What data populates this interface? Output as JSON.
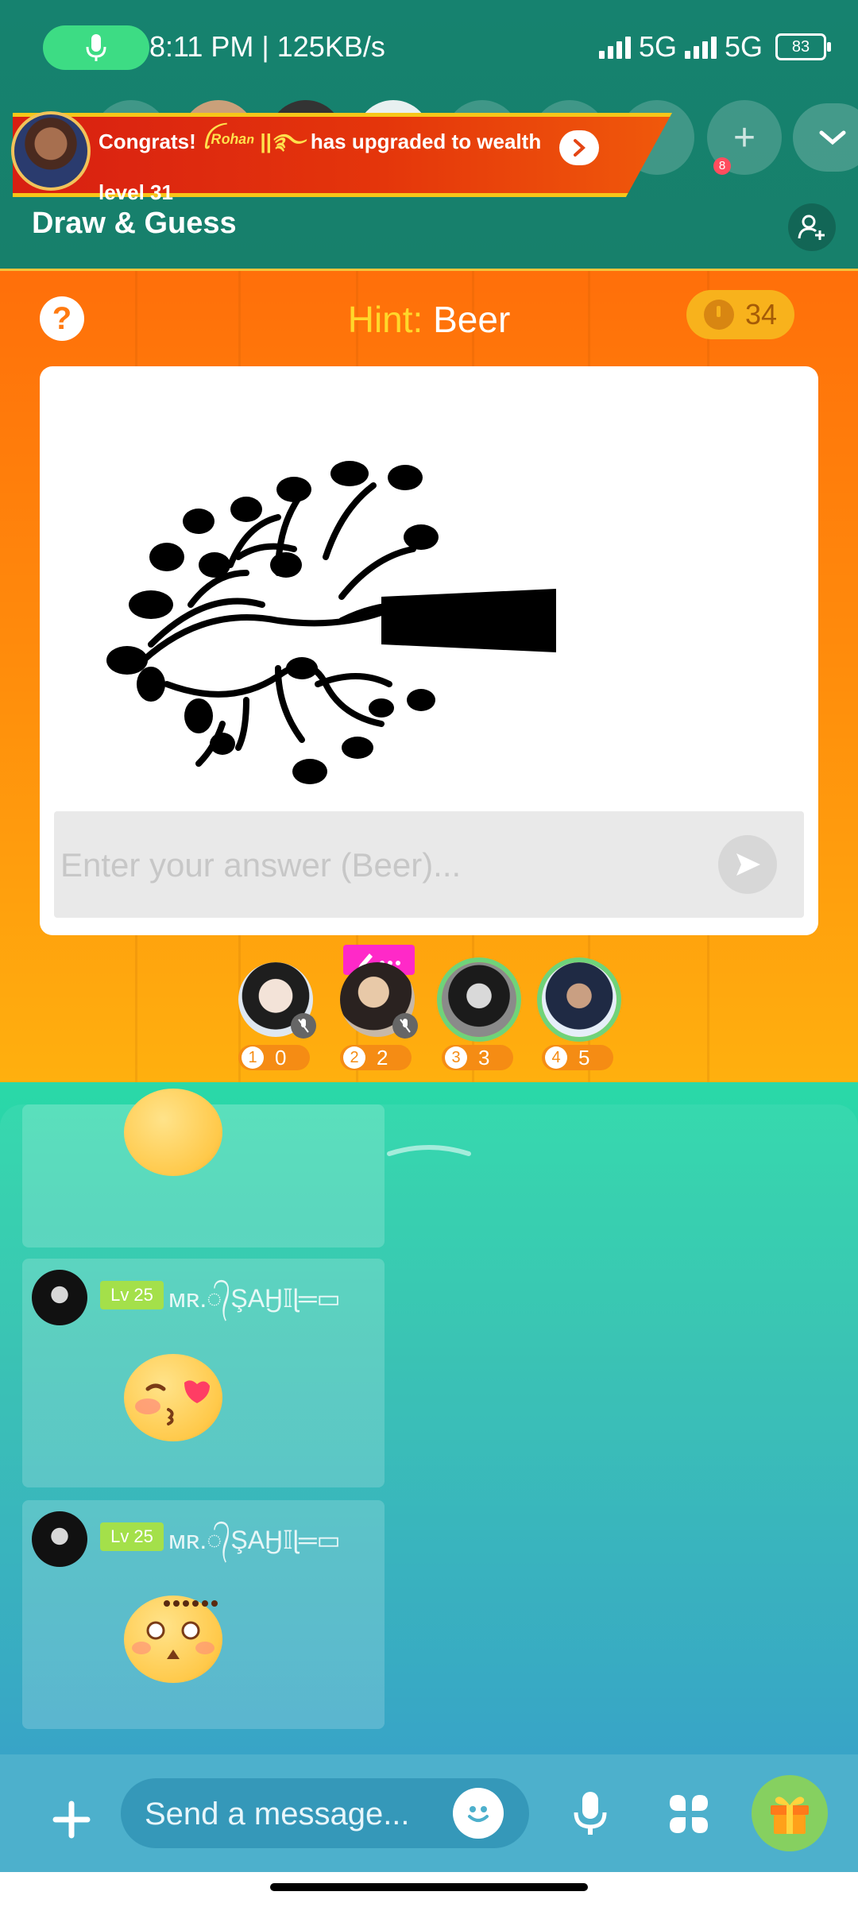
{
  "status": {
    "time_speed": "8:11 PM | 125KB/s",
    "network1": "5G",
    "network2": "5G",
    "battery": "83"
  },
  "header": {
    "banner": {
      "prefix": "Congrats! ",
      "user": "ꪶᴿᵒʰᵃⁿ ||࿐",
      "suffix": " has upgraded to wealth level 31"
    },
    "seat_badge": "8",
    "room_title": "Draw & Guess",
    "icons": {
      "mic": "mic-icon",
      "invite": "add-user-icon",
      "collapse": "chevron-down-icon"
    }
  },
  "game": {
    "hint_label": "Hint: ",
    "hint_word": "Beer",
    "timer": "34",
    "answer_placeholder": "Enter your answer (Beer)...",
    "players": [
      {
        "rank": "1",
        "score": "0"
      },
      {
        "rank": "2",
        "score": "2"
      },
      {
        "rank": "3",
        "score": "3"
      },
      {
        "rank": "4",
        "score": "5"
      }
    ]
  },
  "chat": {
    "messages": [
      {
        "level": "Lv 25",
        "nick": "ᴍʀ.᭄ŞΑӇ𝕀ɭ═▭",
        "emoji": "kiss-emoji"
      },
      {
        "level": "Lv 25",
        "nick": "ᴍʀ.᭄ŞΑӇ𝕀ɭ═▭",
        "emoji": "surprised-emoji"
      }
    ]
  },
  "bottom": {
    "message_placeholder": "Send a message..."
  },
  "colors": {
    "header": "#17806b",
    "game_top": "#ff6f0a",
    "game_bottom": "#ffb00e",
    "hint_label": "#ffd82b",
    "chat_top": "#2ad9a8",
    "chat_bottom": "#2c9fc4",
    "level_badge": "#a4e04a",
    "drawer_tag": "#ff29c8"
  }
}
